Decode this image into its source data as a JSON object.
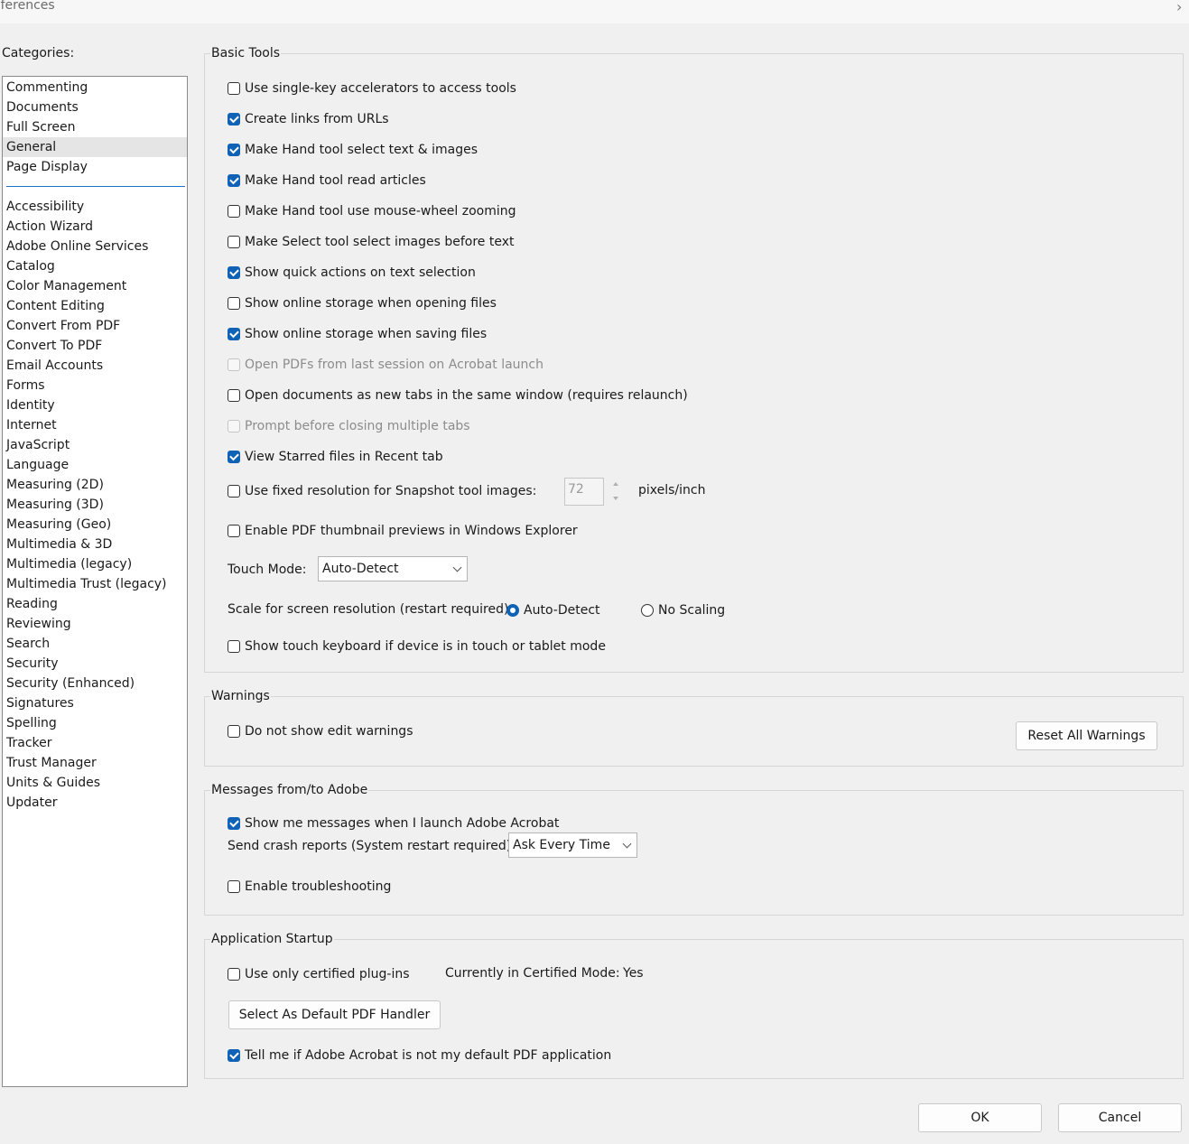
{
  "window": {
    "title": "eferences"
  },
  "categories": {
    "label": "Categories:",
    "top_items": [
      "Commenting",
      "Documents",
      "Full Screen",
      "General",
      "Page Display"
    ],
    "selected": "General",
    "items": [
      "Accessibility",
      "Action Wizard",
      "Adobe Online Services",
      "Catalog",
      "Color Management",
      "Content Editing",
      "Convert From PDF",
      "Convert To PDF",
      "Email Accounts",
      "Forms",
      "Identity",
      "Internet",
      "JavaScript",
      "Language",
      "Measuring (2D)",
      "Measuring (3D)",
      "Measuring (Geo)",
      "Multimedia & 3D",
      "Multimedia (legacy)",
      "Multimedia Trust (legacy)",
      "Reading",
      "Reviewing",
      "Search",
      "Security",
      "Security (Enhanced)",
      "Signatures",
      "Spelling",
      "Tracker",
      "Trust Manager",
      "Units & Guides",
      "Updater"
    ]
  },
  "basic_tools": {
    "title": "Basic Tools",
    "options": [
      {
        "label": "Use single-key accelerators to access tools",
        "checked": false,
        "disabled": false
      },
      {
        "label": "Create links from URLs",
        "checked": true,
        "disabled": false
      },
      {
        "label": "Make Hand tool select text & images",
        "checked": true,
        "disabled": false
      },
      {
        "label": "Make Hand tool read articles",
        "checked": true,
        "disabled": false
      },
      {
        "label": "Make Hand tool use mouse-wheel zooming",
        "checked": false,
        "disabled": false
      },
      {
        "label": "Make Select tool select images before text",
        "checked": false,
        "disabled": false
      },
      {
        "label": "Show quick actions on text selection",
        "checked": true,
        "disabled": false
      },
      {
        "label": "Show online storage when opening files",
        "checked": false,
        "disabled": false
      },
      {
        "label": "Show online storage when saving files",
        "checked": true,
        "disabled": false
      },
      {
        "label": "Open PDFs from last session on Acrobat launch",
        "checked": false,
        "disabled": true
      },
      {
        "label": "Open documents as new tabs in the same window (requires relaunch)",
        "checked": false,
        "disabled": false
      },
      {
        "label": "Prompt before closing multiple tabs",
        "checked": false,
        "disabled": true
      },
      {
        "label": "View Starred files in Recent tab",
        "checked": true,
        "disabled": false
      }
    ],
    "snapshot": {
      "label": "Use fixed resolution for Snapshot tool images:",
      "checked": false,
      "value": "72",
      "unit": "pixels/inch"
    },
    "thumbnail": {
      "label": "Enable PDF thumbnail previews in Windows Explorer",
      "checked": false
    },
    "touch_mode": {
      "label": "Touch Mode:",
      "value": "Auto-Detect"
    },
    "scale": {
      "label": "Scale for screen resolution (restart required):",
      "option_auto": "Auto-Detect",
      "option_none": "No Scaling",
      "selected": "Auto-Detect"
    },
    "touch_keyboard": {
      "label": "Show touch keyboard if device is in touch or tablet mode",
      "checked": false
    }
  },
  "warnings": {
    "title": "Warnings",
    "do_not_show": {
      "label": "Do not show edit warnings",
      "checked": false
    },
    "reset_button": "Reset All Warnings"
  },
  "messages": {
    "title": "Messages from/to Adobe",
    "show_messages": {
      "label": "Show me messages when I launch Adobe Acrobat",
      "checked": true
    },
    "crash_reports": {
      "label": "Send crash reports (System restart required):",
      "value": "Ask Every Time"
    },
    "troubleshooting": {
      "label": "Enable troubleshooting",
      "checked": false
    }
  },
  "startup": {
    "title": "Application Startup",
    "certified": {
      "label": "Use only certified plug-ins",
      "checked": false
    },
    "certified_mode_label": "Currently in Certified Mode:",
    "certified_mode_value": "Yes",
    "default_handler_button": "Select As Default PDF Handler",
    "tell_me": {
      "label": "Tell me if Adobe Acrobat is not my default PDF application",
      "checked": true
    }
  },
  "footer": {
    "ok": "OK",
    "cancel": "Cancel"
  }
}
